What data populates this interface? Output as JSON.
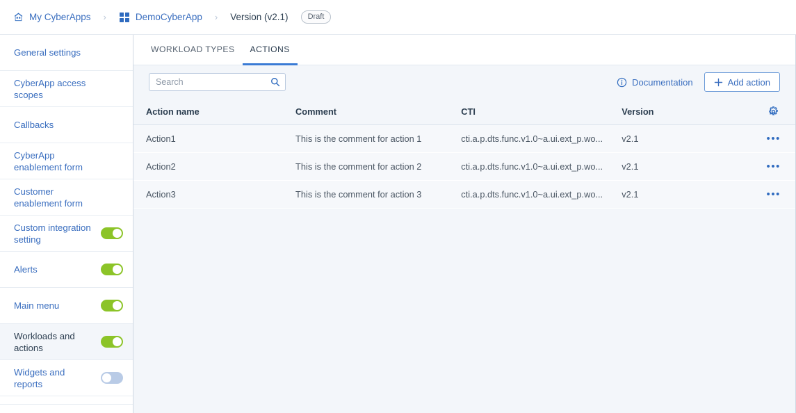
{
  "breadcrumb": {
    "home_label": "My CyberApps",
    "home_icon": "home-icon",
    "separator": "›",
    "app_label": "DemoCyberApp",
    "app_icon": "grid-icon",
    "version_label": "Version (v2.1)",
    "status_badge": "Draft"
  },
  "sidebar": {
    "items": [
      {
        "label": "General settings",
        "toggle": null,
        "selected": false
      },
      {
        "label": "CyberApp access scopes",
        "toggle": null,
        "selected": false
      },
      {
        "label": "Callbacks",
        "toggle": null,
        "selected": false
      },
      {
        "label": "CyberApp enablement form",
        "toggle": null,
        "selected": false
      },
      {
        "label": "Customer enablement form",
        "toggle": null,
        "selected": false
      },
      {
        "label": "Custom integration setting",
        "toggle": "on",
        "selected": false
      },
      {
        "label": "Alerts",
        "toggle": "on",
        "selected": false
      },
      {
        "label": "Main menu",
        "toggle": "on",
        "selected": false
      },
      {
        "label": "Workloads and actions",
        "toggle": "on",
        "selected": true
      },
      {
        "label": "Widgets and reports",
        "toggle": "off",
        "selected": false
      }
    ]
  },
  "tabs": [
    {
      "label": "WORKLOAD TYPES",
      "active": false
    },
    {
      "label": "ACTIONS",
      "active": true
    }
  ],
  "toolbar": {
    "search_placeholder": "Search",
    "search_value": "",
    "search_icon": "search-icon",
    "documentation_label": "Documentation",
    "documentation_icon": "info-circle-icon",
    "add_action_label": "Add action",
    "add_action_icon": "plus-icon"
  },
  "table": {
    "columns": [
      "Action name",
      "Comment",
      "CTI",
      "Version"
    ],
    "settings_icon": "gear-icon",
    "row_menu_glyph": "•••",
    "rows": [
      {
        "name": "Action1",
        "comment": "This is the comment for action 1",
        "cti": "cti.a.p.dts.func.v1.0~a.ui.ext_p.wo...",
        "version": "v2.1"
      },
      {
        "name": "Action2",
        "comment": "This is the comment for action 2",
        "cti": "cti.a.p.dts.func.v1.0~a.ui.ext_p.wo...",
        "version": "v2.1"
      },
      {
        "name": "Action3",
        "comment": "This is the comment for action 3",
        "cti": "cti.a.p.dts.func.v1.0~a.ui.ext_p.wo...",
        "version": "v2.1"
      }
    ]
  },
  "colors": {
    "link_blue": "#3a6ebf",
    "accent_blue": "#3a7bd5",
    "toggle_on_green": "#8cc428",
    "toggle_off_grey": "#b9cbe6",
    "panel_bg": "#f3f6fa",
    "row_bg": "#f6f8fb"
  }
}
